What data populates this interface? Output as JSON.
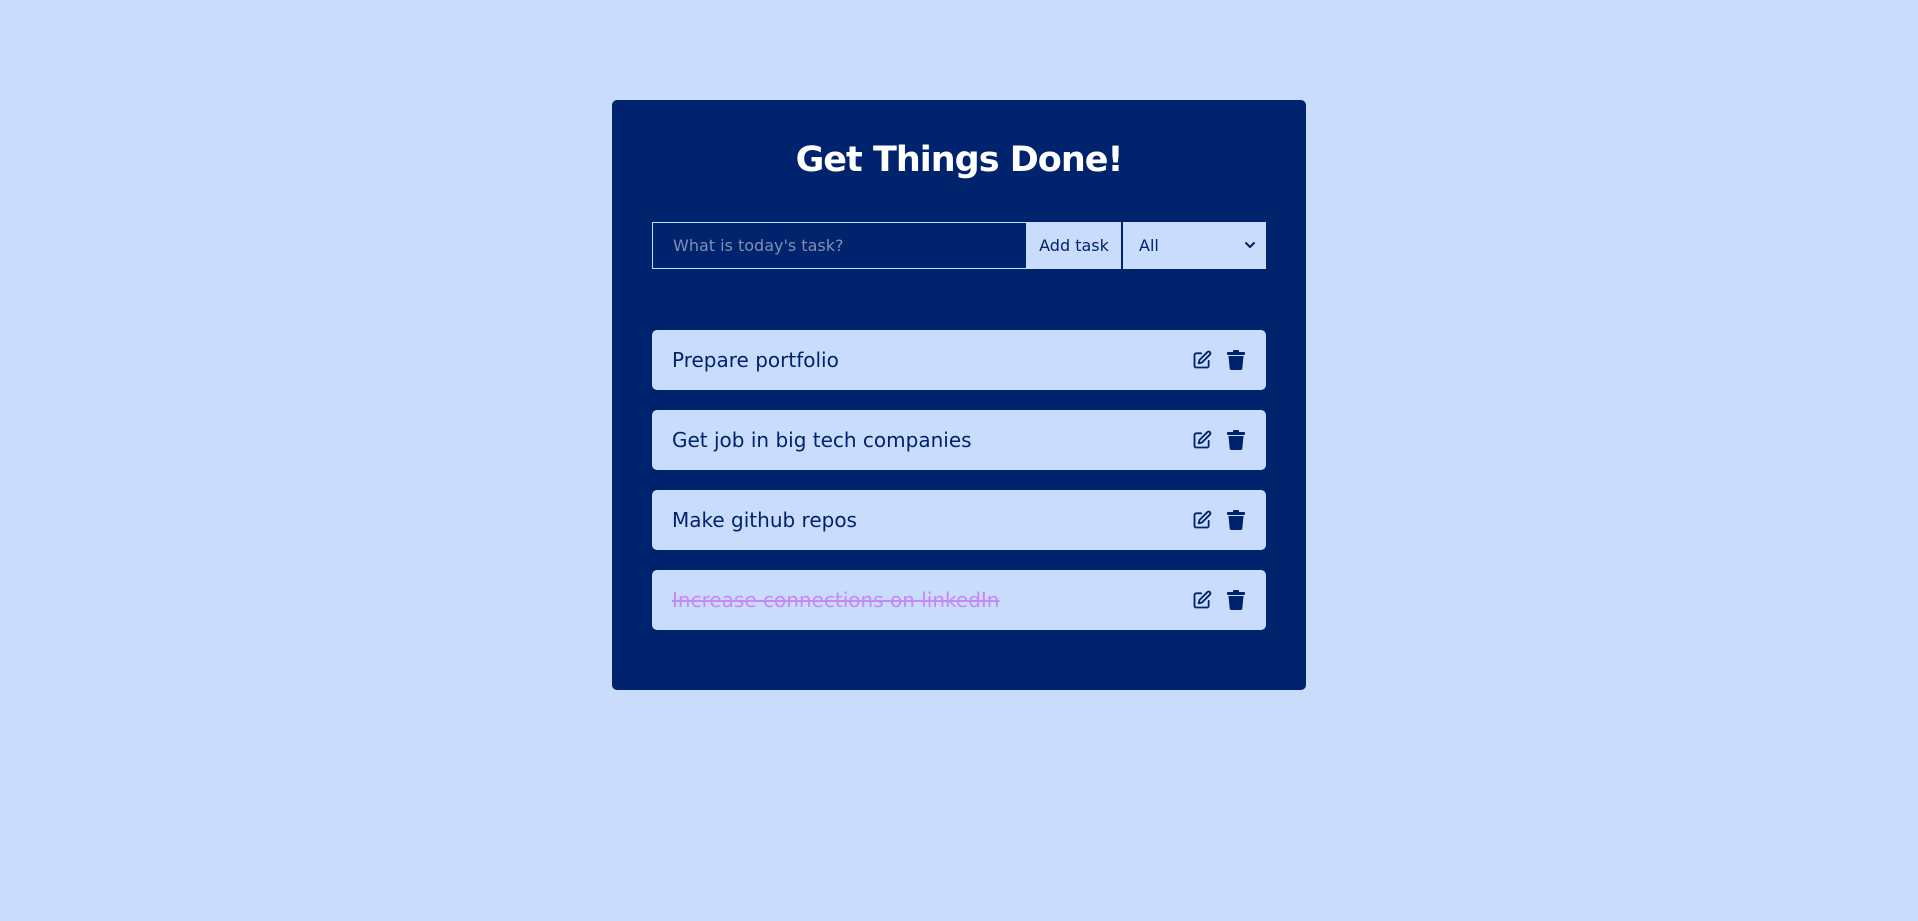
{
  "header": {
    "title": "Get Things Done!"
  },
  "form": {
    "placeholder": "What is today's task?",
    "value": "",
    "add_label": "Add task",
    "filter_selected": "All"
  },
  "tasks": [
    {
      "text": "Prepare portfolio",
      "completed": false
    },
    {
      "text": "Get job in big tech companies",
      "completed": false
    },
    {
      "text": "Make github repos",
      "completed": false
    },
    {
      "text": "Increase connections on linkedIn",
      "completed": true
    }
  ],
  "icons": {
    "edit": "edit-icon",
    "delete": "trash-icon",
    "dropdown": "chevron-down-icon"
  },
  "colors": {
    "background": "#c9dcfb",
    "card": "#00236d",
    "completed_text": "#c58af9"
  }
}
